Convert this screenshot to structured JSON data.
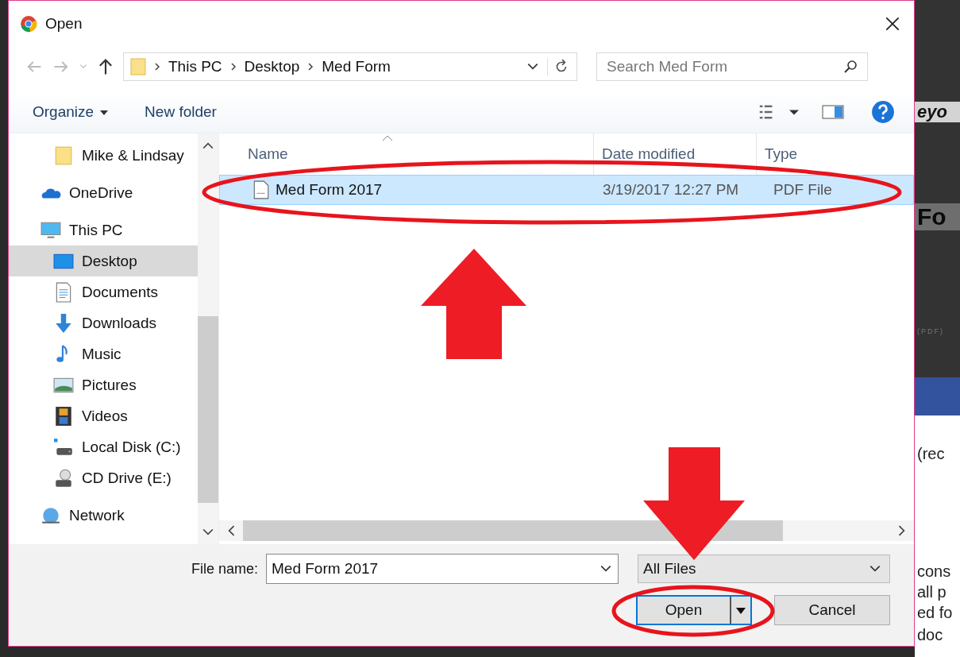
{
  "window": {
    "title": "Open"
  },
  "address": {
    "crumbs": [
      "This PC",
      "Desktop",
      "Med Form"
    ]
  },
  "search": {
    "placeholder": "Search Med Form"
  },
  "toolbar": {
    "organize": "Organize",
    "new_folder": "New folder"
  },
  "sidebar": {
    "items": [
      {
        "label": "Mike & Lindsay",
        "kind": "folder",
        "selected": false
      },
      {
        "label": "OneDrive",
        "kind": "cloud",
        "selected": false
      },
      {
        "label": "This PC",
        "kind": "pc",
        "selected": false
      },
      {
        "label": "Desktop",
        "kind": "desktop",
        "selected": true
      },
      {
        "label": "Documents",
        "kind": "document",
        "selected": false
      },
      {
        "label": "Downloads",
        "kind": "download",
        "selected": false
      },
      {
        "label": "Music",
        "kind": "music",
        "selected": false
      },
      {
        "label": "Pictures",
        "kind": "picture",
        "selected": false
      },
      {
        "label": "Videos",
        "kind": "video",
        "selected": false
      },
      {
        "label": "Local Disk (C:)",
        "kind": "disk",
        "selected": false
      },
      {
        "label": "CD Drive (E:)",
        "kind": "cd",
        "selected": false
      },
      {
        "label": "Network",
        "kind": "network",
        "selected": false
      }
    ]
  },
  "table": {
    "columns": [
      "Name",
      "Date modified",
      "Type"
    ],
    "rows": [
      {
        "name": "Med Form 2017",
        "date": "3/19/2017 12:27 PM",
        "type": "PDF File",
        "selected": true
      }
    ]
  },
  "file_name": {
    "label": "File name:",
    "value": "Med Form 2017"
  },
  "file_type": {
    "value": "All Files"
  },
  "buttons": {
    "open": "Open",
    "cancel": "Cancel"
  },
  "background_page": {
    "fragments": [
      "eyo",
      "Fo",
      "(PDF)",
      "(rec",
      "cons",
      "all p",
      "ed fo",
      "doc"
    ]
  }
}
